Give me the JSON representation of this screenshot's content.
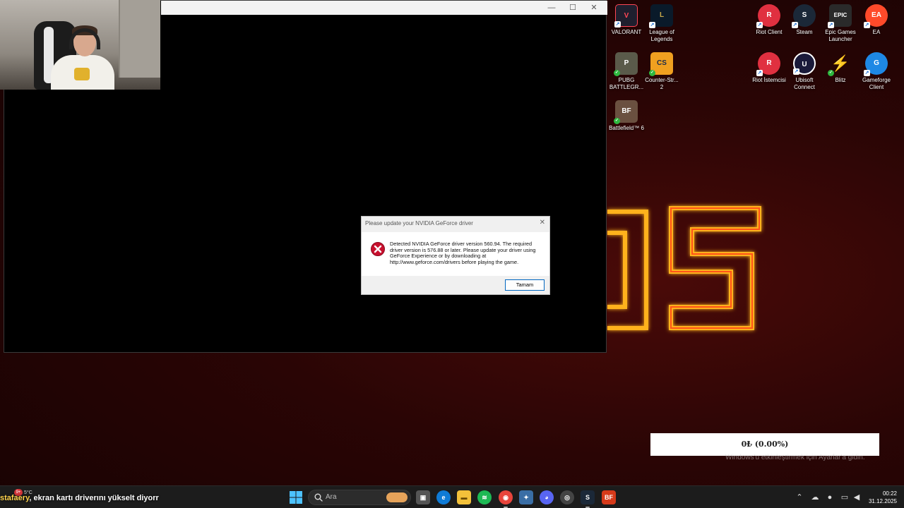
{
  "webcam": {},
  "game_window": {
    "controls": {
      "minimize": "—",
      "maximize": "☐",
      "close": "✕"
    }
  },
  "dialog": {
    "title": "Please update your NVIDIA GeForce driver",
    "close": "✕",
    "message": "Detected NVIDIA GeForce driver version 560.94. The required driver version is 576.88 or later. Please update your driver using GeForce Experience or by downloading at http://www.geforce.com/drivers before playing the game.",
    "ok_label": "Tamam"
  },
  "desktop": {
    "icons": [
      {
        "label": "VALORANT"
      },
      {
        "label": "League of Legends"
      },
      {
        "label": "PUBG BATTLEGR..."
      },
      {
        "label": "Counter-Str... 2"
      },
      {
        "label": "Battlefield™ 6"
      },
      {
        "label": "Riot Client"
      },
      {
        "label": "Steam"
      },
      {
        "label": "Epic Games Launcher"
      },
      {
        "label": "EA"
      },
      {
        "label": "Riot İstemcisi"
      },
      {
        "label": "Ubisoft Connect"
      },
      {
        "label": "Blitz"
      },
      {
        "label": "Gameforge Client"
      }
    ]
  },
  "widget": {
    "amount": "0₺ (0.00%)",
    "activate_text": "Windows'u etkinleştirmek için Ayarlar'a gidin."
  },
  "taskbar": {
    "weather_badge": "9+",
    "weather_temp": "5°C",
    "ticker_user": "stafaery",
    "ticker_text": "ekran kartı driverını yükselt diyorr",
    "search_placeholder": "Ara",
    "clock_time": "00:22",
    "clock_date": "31.12.2025"
  },
  "colors": {
    "accent": "#0067c0",
    "error_red": "#c8102e",
    "neon": "#ff3b1a"
  }
}
